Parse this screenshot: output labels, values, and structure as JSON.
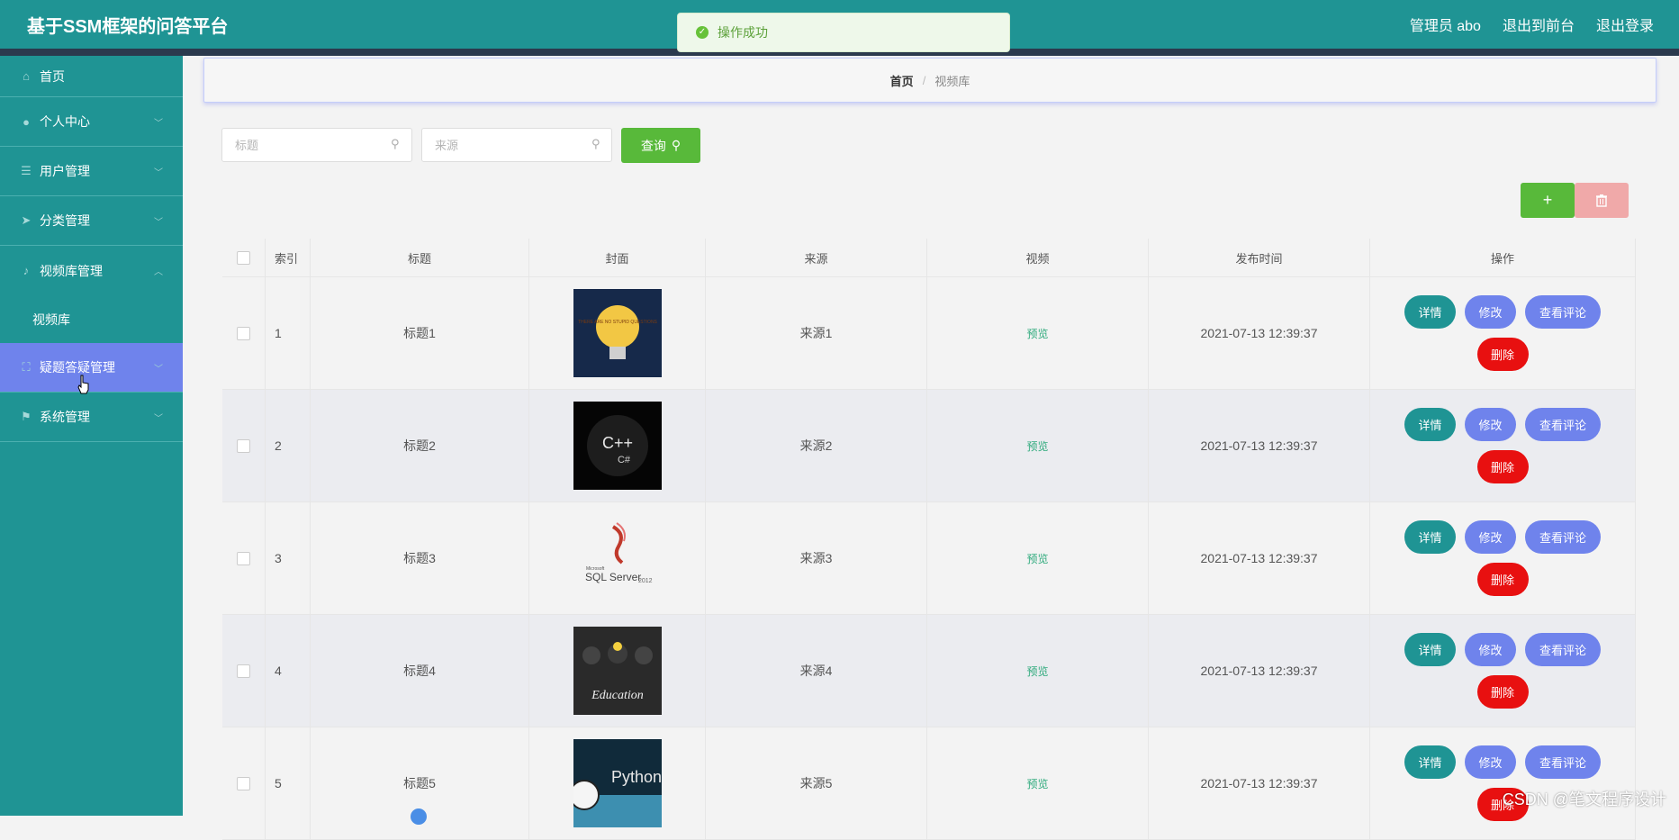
{
  "app": {
    "title": "基于SSM框架的问答平台"
  },
  "header": {
    "admin_label": "管理员 abo",
    "front_label": "退出到前台",
    "logout_label": "退出登录"
  },
  "toast": {
    "message": "操作成功"
  },
  "sidebar": {
    "items": [
      {
        "label": "首页",
        "icon": "home-icon"
      },
      {
        "label": "个人中心",
        "icon": "user-icon"
      },
      {
        "label": "用户管理",
        "icon": "list-icon"
      },
      {
        "label": "分类管理",
        "icon": "send-icon"
      },
      {
        "label": "视频库管理",
        "icon": "mic-icon"
      },
      {
        "label": "视频库",
        "icon": ""
      },
      {
        "label": "疑题答疑管理",
        "icon": "expand-icon"
      },
      {
        "label": "系统管理",
        "icon": "flag-icon"
      }
    ]
  },
  "breadcrumb": {
    "home": "首页",
    "separator": "/",
    "current": "视频库"
  },
  "search": {
    "title_placeholder": "标题",
    "source_placeholder": "来源",
    "query_label": "查询"
  },
  "actions": {
    "add_label": "+"
  },
  "table": {
    "headers": [
      "索引",
      "标题",
      "封面",
      "来源",
      "视频",
      "发布时间",
      "操作"
    ],
    "rows": [
      {
        "index": "1",
        "title": "标题1",
        "source": "来源1",
        "video": "预览",
        "time": "2021-07-13 12:39:37",
        "cover": "bulb"
      },
      {
        "index": "2",
        "title": "标题2",
        "source": "来源2",
        "video": "预览",
        "time": "2021-07-13 12:39:37",
        "cover": "cpp"
      },
      {
        "index": "3",
        "title": "标题3",
        "source": "来源3",
        "video": "预览",
        "time": "2021-07-13 12:39:37",
        "cover": "sqlserver"
      },
      {
        "index": "4",
        "title": "标题4",
        "source": "来源4",
        "video": "预览",
        "time": "2021-07-13 12:39:37",
        "cover": "education"
      },
      {
        "index": "5",
        "title": "标题5",
        "source": "来源5",
        "video": "预览",
        "time": "2021-07-13 12:39:37",
        "cover": "python"
      }
    ],
    "ops": {
      "detail": "详情",
      "edit": "修改",
      "comments": "查看评论",
      "delete": "删除"
    }
  },
  "covers": {
    "bulb_text": "THERE ARE NO STUPID QUESTIONS",
    "cpp_text": "C++",
    "cpp_sub": "C#",
    "sql_brand": "Microsoft",
    "sql_name": "SQL Server",
    "sql_year": "2012",
    "edu_text": "Education",
    "py_text": "Python"
  },
  "watermark": "CSDN @笔文程序设计"
}
